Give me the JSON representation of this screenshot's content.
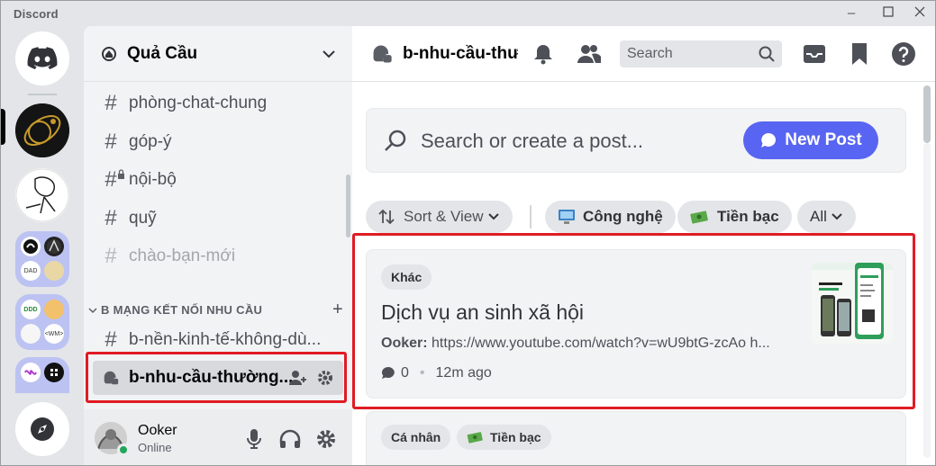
{
  "app": {
    "title": "Discord",
    "window_controls": [
      "minimize",
      "maximize",
      "close"
    ]
  },
  "server_rail": {
    "servers": [
      {
        "name": "home",
        "icon": "discord-logo-icon"
      },
      {
        "name": "server-gold-orbit",
        "icon": "server-avatar"
      },
      {
        "name": "server-sketch",
        "icon": "server-avatar"
      },
      {
        "name": "folder-1",
        "minis": [
          "",
          "",
          "DAD",
          ""
        ]
      },
      {
        "name": "folder-2",
        "minis": [
          "DDD",
          "",
          "",
          "<WM>"
        ]
      },
      {
        "name": "folder-3",
        "minis": [
          "",
          ""
        ]
      },
      {
        "name": "explore",
        "icon": "compass-icon"
      }
    ]
  },
  "sidebar": {
    "server_name": "Quả Cầu",
    "channels": [
      {
        "name": "phòng-chat-chung",
        "type": "text"
      },
      {
        "name": "góp-ý",
        "type": "text"
      },
      {
        "name": "nội-bộ",
        "type": "locked"
      },
      {
        "name": "quỹ",
        "type": "text"
      },
      {
        "name": "chào-bạn-mới",
        "type": "text",
        "muted": true
      }
    ],
    "category": {
      "name": "B MẠNG KẾT NỐI NHU CẦU",
      "channels": [
        {
          "name": "b-nền-kinh-tế-không-dù...",
          "type": "text"
        },
        {
          "name": "b-nhu-cầu-thường...",
          "type": "forum",
          "active": true
        }
      ]
    }
  },
  "user_panel": {
    "username": "Ooker",
    "status": "Online",
    "status_color": "#23a55a"
  },
  "main": {
    "channel_title": "b-nhu-cầu-thườ",
    "search_placeholder": "Search",
    "create_post_placeholder": "Search or create a post...",
    "new_post_label": "New Post",
    "filters": {
      "sort_view": "Sort & View",
      "tags": [
        "Công nghệ",
        "Tiền bạc"
      ],
      "all": "All"
    },
    "posts": [
      {
        "tag": "Khác",
        "title": "Dịch vụ an sinh xã hội",
        "author": "Ooker:",
        "preview": "https://www.youtube.com/watch?v=wU9btG-zcAo h...",
        "comments": "0",
        "time": "12m ago",
        "thumbnail_text": "GIỚI THIỆU ỨNG DỤNG"
      },
      {
        "tags": [
          "Cá nhân",
          "Tiền bạc"
        ]
      }
    ]
  },
  "colors": {
    "accent": "#5865f2",
    "highlight": "#e01b24",
    "online": "#23a55a"
  }
}
